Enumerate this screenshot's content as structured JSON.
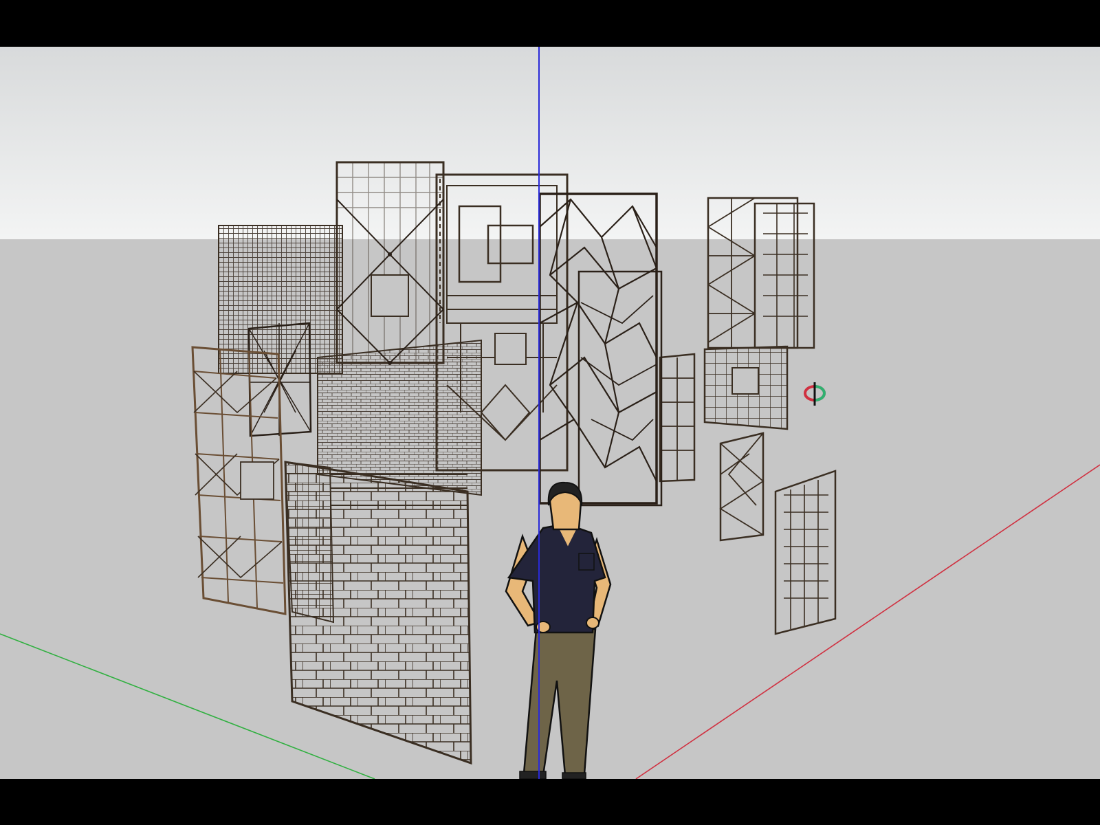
{
  "app": {
    "viewport_kind": "3d-model-viewport"
  },
  "colors": {
    "sky_top": "#d8dadb",
    "sky_bottom": "#f3f4f4",
    "ground": "#c6c6c6",
    "panel_stroke": "#3a2e22",
    "panel_rust": "#8a6a4a",
    "axis_blue": "#2a2ad8",
    "axis_red": "#d03040",
    "axis_green": "#30b040",
    "shirt": "#23243a",
    "pants": "#6e6448",
    "skin": "#e8b878"
  },
  "scene": {
    "panels": [
      "grid-square-panel",
      "key-pattern-panel",
      "voronoi-panel",
      "dense-mesh-panel",
      "cross-pattern-panel",
      "small-diagonal-panel",
      "maze-panel-front",
      "fine-mesh-panel",
      "upper-right-panel",
      "ring-panel",
      "triangle-panel",
      "spiral-panel",
      "side-strip-panel"
    ],
    "figure": "scale-person",
    "tool_cursor": "orbit-cursor-icon"
  }
}
